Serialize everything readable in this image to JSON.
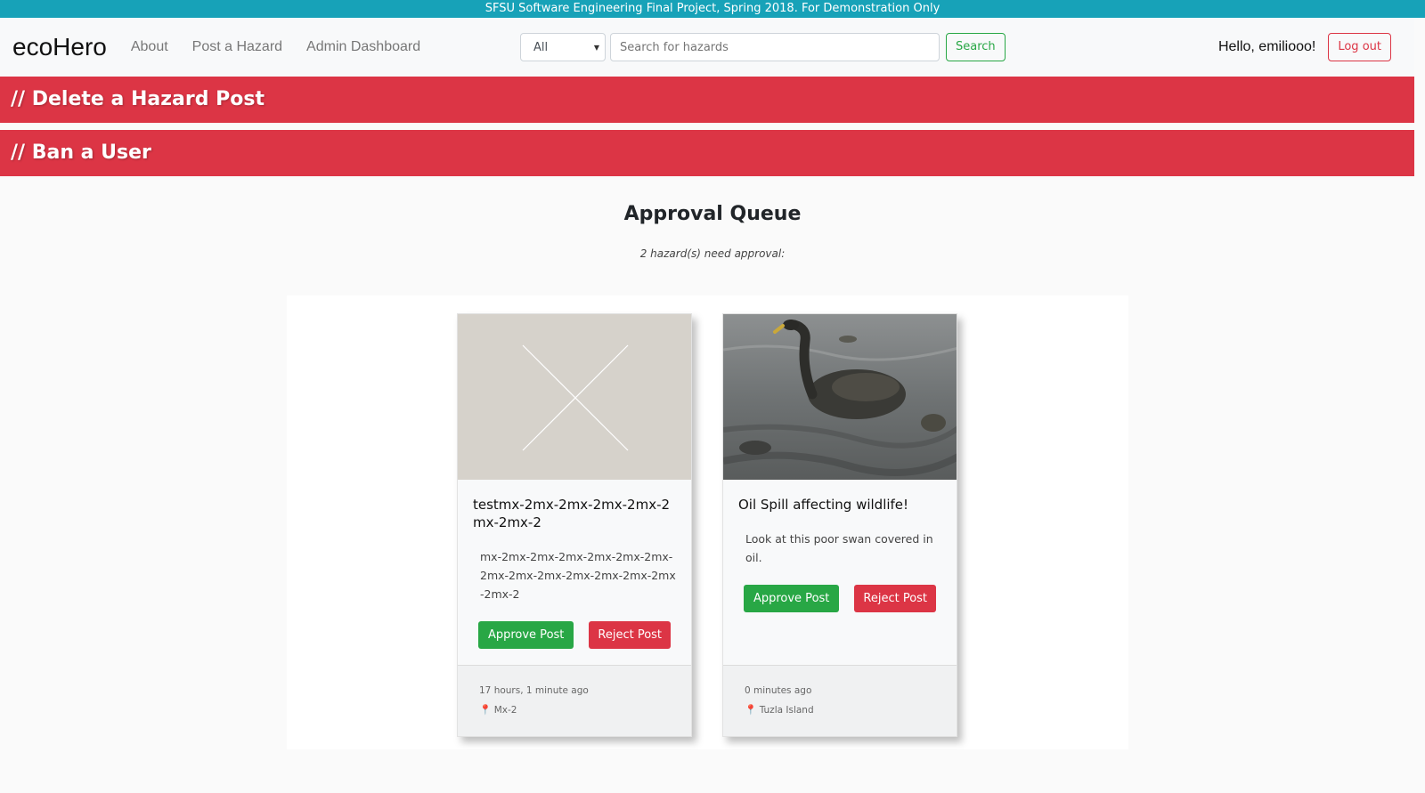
{
  "banner": {
    "text": "SFSU Software Engineering Final Project, Spring 2018. For Demonstration Only"
  },
  "nav": {
    "brand": "ecoHero",
    "links": [
      "About",
      "Post a Hazard",
      "Admin Dashboard"
    ],
    "category_select": "All",
    "search_placeholder": "Search for hazards",
    "search_button": "Search",
    "greeting": "Hello, emiliooo!",
    "logout_button": "Log out"
  },
  "admin_sections": {
    "delete_post": "// Delete a Hazard Post",
    "ban_user": "// Ban a User"
  },
  "queue": {
    "title": "Approval Queue",
    "subtitle": "2 hazard(s) need approval:",
    "cards": [
      {
        "title": "testmx-2mx-2mx-2mx-2mx-2mx-2mx-2",
        "description": "mx-2mx-2mx-2mx-2mx-2mx-2mx-2mx-2mx-2mx-2mx-2mx-2mx-2mx-2mx-2",
        "approve_label": "Approve Post",
        "reject_label": "Reject Post",
        "time": "17 hours, 1 minute ago",
        "location": "Mx-2",
        "image": "placeholder-x"
      },
      {
        "title": "Oil Spill affecting wildlife!",
        "description": "Look at this poor swan covered in oil.",
        "approve_label": "Approve Post",
        "reject_label": "Reject Post",
        "time": "0 minutes ago",
        "location": "Tuzla Island",
        "image": "oil-covered-swan-photo"
      }
    ]
  },
  "colors": {
    "banner": "#17a2b8",
    "danger": "#dc3545",
    "success": "#28a745"
  }
}
